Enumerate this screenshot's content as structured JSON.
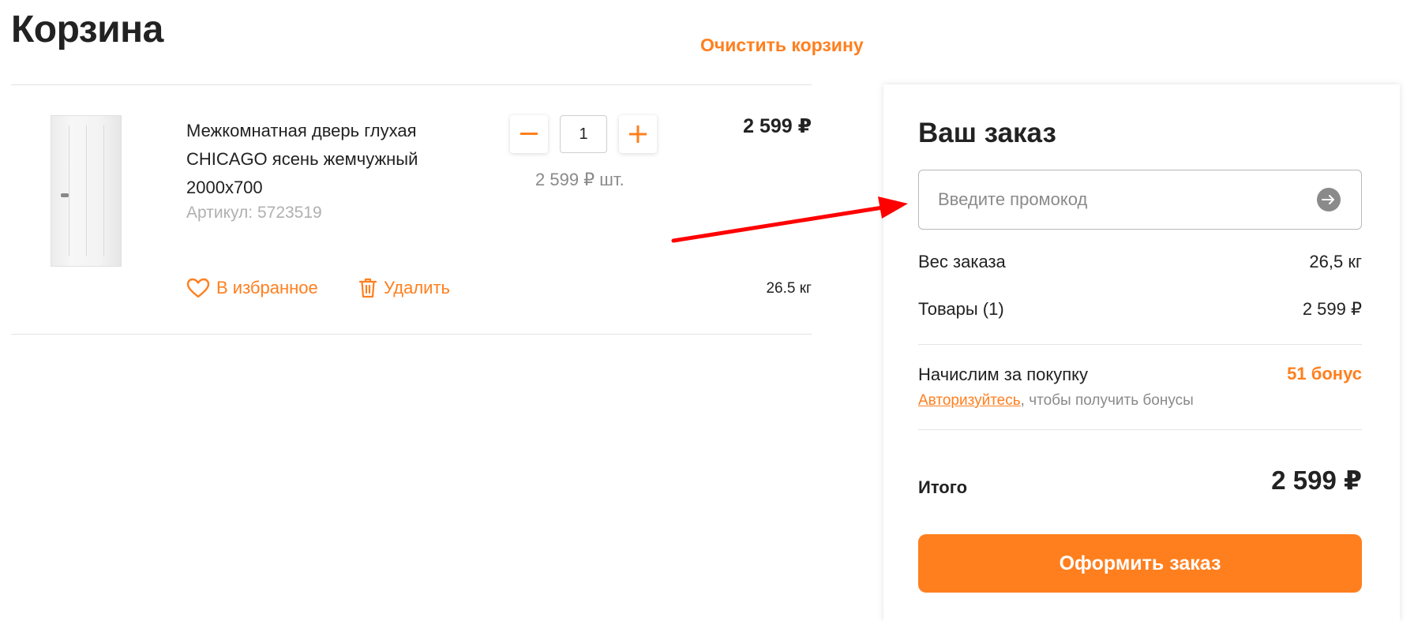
{
  "cart": {
    "title": "Корзина",
    "clear_label": "Очистить корзину"
  },
  "item": {
    "title": "Межкомнатная дверь глухая CHICAGO ясень жемчужный 2000x700",
    "sku_label": "Артикул: ",
    "sku_value": "5723519",
    "quantity": "1",
    "unit_price": "2 599 ₽ шт.",
    "price": "2 599 ₽",
    "weight": "26.5 кг",
    "favorite_label": "В избранное",
    "delete_label": "Удалить"
  },
  "order": {
    "title": "Ваш заказ",
    "promo_placeholder": "Введите промокод",
    "weight_label": "Вес заказа",
    "weight_value": "26,5 кг",
    "goods_label": "Товары (1)",
    "goods_value": "2 599 ₽",
    "bonus_label": "Начислим за покупку",
    "bonus_value": "51 бонус",
    "auth_link": "Авторизуйтесь",
    "auth_hint": ", чтобы получить бонусы",
    "total_label": "Итого",
    "total_value": "2 599 ₽",
    "checkout_label": "Оформить заказ"
  },
  "icons": {
    "favorite": "heart-icon",
    "delete": "trash-icon",
    "promo_submit": "arrow-right-circle-icon",
    "minus": "minus-icon",
    "plus": "plus-icon"
  },
  "colors": {
    "accent": "#ff7f1e",
    "muted": "#8a8a8a",
    "annotation": "#ff0000"
  }
}
